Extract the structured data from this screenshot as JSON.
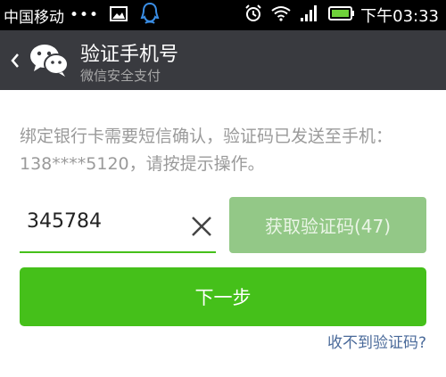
{
  "status_bar": {
    "carrier": "中国移动",
    "dots": "•••",
    "time": "下午03:33",
    "icons": [
      "photo-icon",
      "qq-icon",
      "alarm-icon",
      "wifi-icon",
      "signal-icon",
      "battery-icon"
    ]
  },
  "header": {
    "title": "验证手机号",
    "subtitle": "微信安全支付",
    "back_icon": "chevron-left-icon",
    "logo_icon": "wechat-logo-icon"
  },
  "main": {
    "message": "绑定银行卡需要短信确认，验证码已发送至手机：138****5120，请按提示操作。",
    "code_input_value": "345784",
    "clear_icon": "close-icon",
    "get_code_label": "获取验证码(47)",
    "next_label": "下一步",
    "no_code_link": "收不到验证码?"
  },
  "colors": {
    "statusbar_bg": "#000000",
    "titlebar_bg": "#393a3f",
    "primary_green": "#45c01a",
    "disabled_green": "#93c887",
    "link_blue": "#4a6a9a"
  }
}
